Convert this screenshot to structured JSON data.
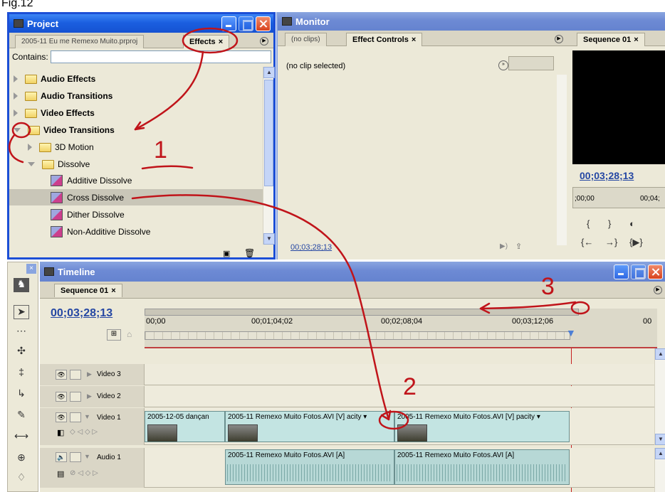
{
  "figure_label": "Fig.12",
  "project": {
    "title": "Project",
    "tabs": [
      "2005-11 Eu me Remexo Muito.prproj",
      "Effects"
    ],
    "contains_label": "Contains:",
    "contains_value": "",
    "tree": [
      {
        "label": "Audio Effects"
      },
      {
        "label": "Audio Transitions"
      },
      {
        "label": "Video Effects"
      },
      {
        "label": "Video Transitions"
      },
      {
        "label": "3D Motion"
      },
      {
        "label": "Dissolve"
      },
      {
        "label": "Additive Dissolve"
      },
      {
        "label": "Cross Dissolve"
      },
      {
        "label": "Dither Dissolve"
      },
      {
        "label": "Non-Additive Dissolve"
      }
    ]
  },
  "monitor": {
    "title": "Monitor",
    "tabs": [
      "(no clips)",
      "Effect Controls",
      "Sequence 01"
    ],
    "no_clip_text": "(no clip selected)",
    "timecode_left": "00;03;28;13",
    "program_timecode": "00;03;28;13",
    "program_ruler_left": ";00;00",
    "program_ruler_right": "00;04;"
  },
  "timeline": {
    "title": "Timeline",
    "sequence_tab": "Sequence 01",
    "timecode": "00;03;28;13",
    "ruler": [
      "00;00",
      "00;01;04;02",
      "00;02;08;04",
      "00;03;12;06",
      "00"
    ],
    "tracks": {
      "video3": "Video 3",
      "video2": "Video 2",
      "video1": "Video 1",
      "audio1": "Audio 1"
    },
    "clips": {
      "v1a": "2005-12-05 dançan",
      "v1b": "2005-11 Remexo Muito Fotos.AVI [V]",
      "v1b_suffix": "acity ▾",
      "v1c": "2005-11 Remexo Muito Fotos.AVI [V]",
      "v1c_suffix": "pacity ▾",
      "a1b": "2005-11 Remexo Muito Fotos.AVI [A]",
      "a1c": "2005-11 Remexo Muito Fotos.AVI [A]"
    }
  },
  "annotations": [
    "1",
    "2",
    "3"
  ],
  "colors": {
    "xp_blue": "#1c4fd6",
    "annotation_red": "#c0141a",
    "panel": "#ece9d8",
    "clip": "#c3e4e2"
  }
}
